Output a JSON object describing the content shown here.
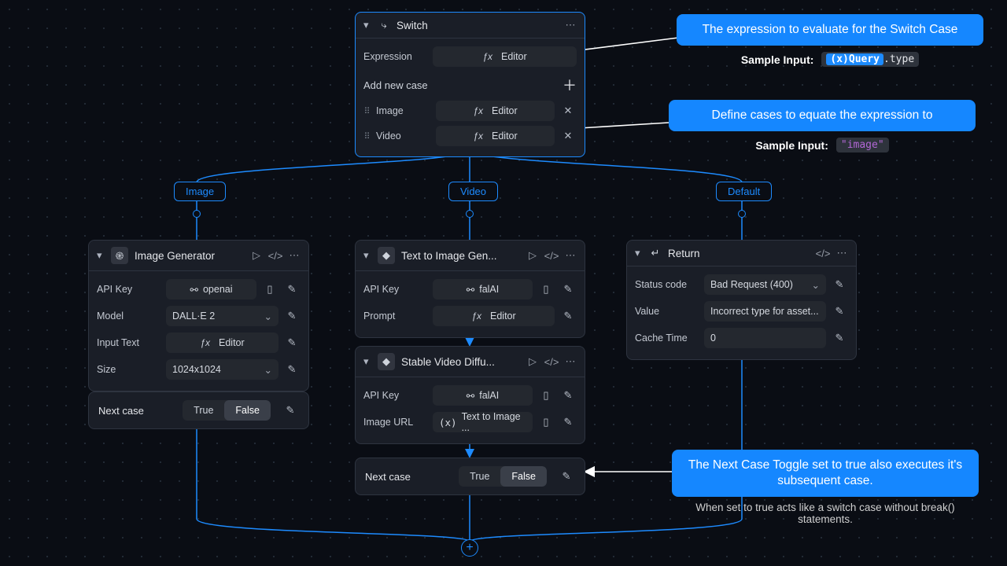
{
  "switch": {
    "title": "Switch",
    "expression_label": "Expression",
    "expression_value": "Editor",
    "add_new": "Add new case",
    "cases": [
      {
        "name": "Image",
        "value": "Editor"
      },
      {
        "name": "Video",
        "value": "Editor"
      }
    ]
  },
  "branches": {
    "image": "Image",
    "video": "Video",
    "default": "Default"
  },
  "image_gen": {
    "title": "Image Generator",
    "rows": {
      "api_key": {
        "label": "API Key",
        "value": "openai"
      },
      "model": {
        "label": "Model",
        "value": "DALL·E 2"
      },
      "input": {
        "label": "Input Text",
        "value": "Editor"
      },
      "size": {
        "label": "Size",
        "value": "1024x1024"
      }
    }
  },
  "text2img": {
    "title": "Text to Image Gen...",
    "rows": {
      "api_key": {
        "label": "API Key",
        "value": "falAI"
      },
      "prompt": {
        "label": "Prompt",
        "value": "Editor"
      }
    }
  },
  "svd": {
    "title": "Stable Video Diffu...",
    "rows": {
      "api_key": {
        "label": "API Key",
        "value": "falAI"
      },
      "image_url": {
        "label": "Image URL",
        "value": "Text to Image ..."
      }
    }
  },
  "return": {
    "title": "Return",
    "rows": {
      "status": {
        "label": "Status code",
        "value": "Bad Request (400)"
      },
      "value": {
        "label": "Value",
        "value": "Incorrect type for asset..."
      },
      "cache": {
        "label": "Cache Time",
        "value": "0"
      }
    }
  },
  "next_case": {
    "label": "Next case",
    "true_label": "True",
    "false_label": "False"
  },
  "callouts": {
    "c1": {
      "text": "The expression to evaluate for the Switch Case",
      "sample_label": "Sample Input:",
      "sample_var": "(x)Query",
      "sample_prop": ".type"
    },
    "c2": {
      "text": "Define cases to equate the expression to",
      "sample_label": "Sample Input:",
      "sample_value": "\"image\""
    },
    "c3": {
      "text": "The Next Case Toggle set to true also executes it's subsequent case.",
      "sub": "When set to true acts like a switch case without break() statements."
    }
  }
}
